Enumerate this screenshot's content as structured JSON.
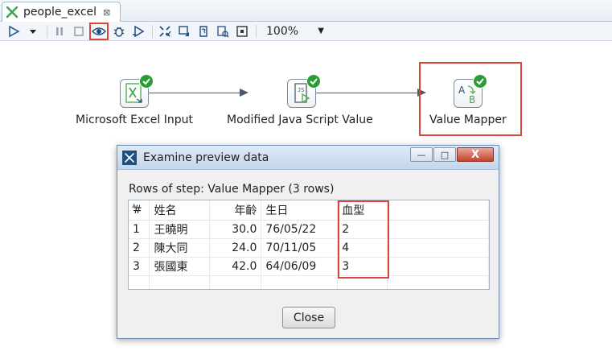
{
  "tab": {
    "title": "people_excel",
    "close_glyph": "⊠"
  },
  "toolbar": {
    "zoom": "100%",
    "icons": [
      "run-icon",
      "dropdown-icon",
      "pause-icon",
      "stop-icon",
      "preview-eye-icon",
      "debug-icon",
      "replay-icon",
      "verify-icon",
      "impact-icon",
      "sql-icon",
      "explore-db-icon",
      "layout-icon"
    ]
  },
  "steps": [
    {
      "name": "Microsoft Excel Input",
      "icon": "excel-input-icon"
    },
    {
      "name": "Modified Java Script Value",
      "icon": "javascript-icon"
    },
    {
      "name": "Value Mapper",
      "icon": "value-mapper-icon"
    }
  ],
  "dialog": {
    "title": "Examine preview data",
    "subtitle": "Rows of step: Value Mapper (3 rows)",
    "columns": [
      "#",
      "姓名",
      "年齡",
      "生日",
      "血型"
    ],
    "rows": [
      [
        "1",
        "王曉明",
        "30.0",
        "76/05/22",
        "2"
      ],
      [
        "2",
        "陳大同",
        "24.0",
        "70/11/05",
        "4"
      ],
      [
        "3",
        "張國東",
        "42.0",
        "64/06/09",
        "3"
      ]
    ],
    "close_label": "Close",
    "win_min": "—",
    "win_max": "□",
    "win_close": "X"
  },
  "colors": {
    "highlight": "#d9453b",
    "check_green": "#2a9d36",
    "accent_green": "#4aa84a"
  }
}
